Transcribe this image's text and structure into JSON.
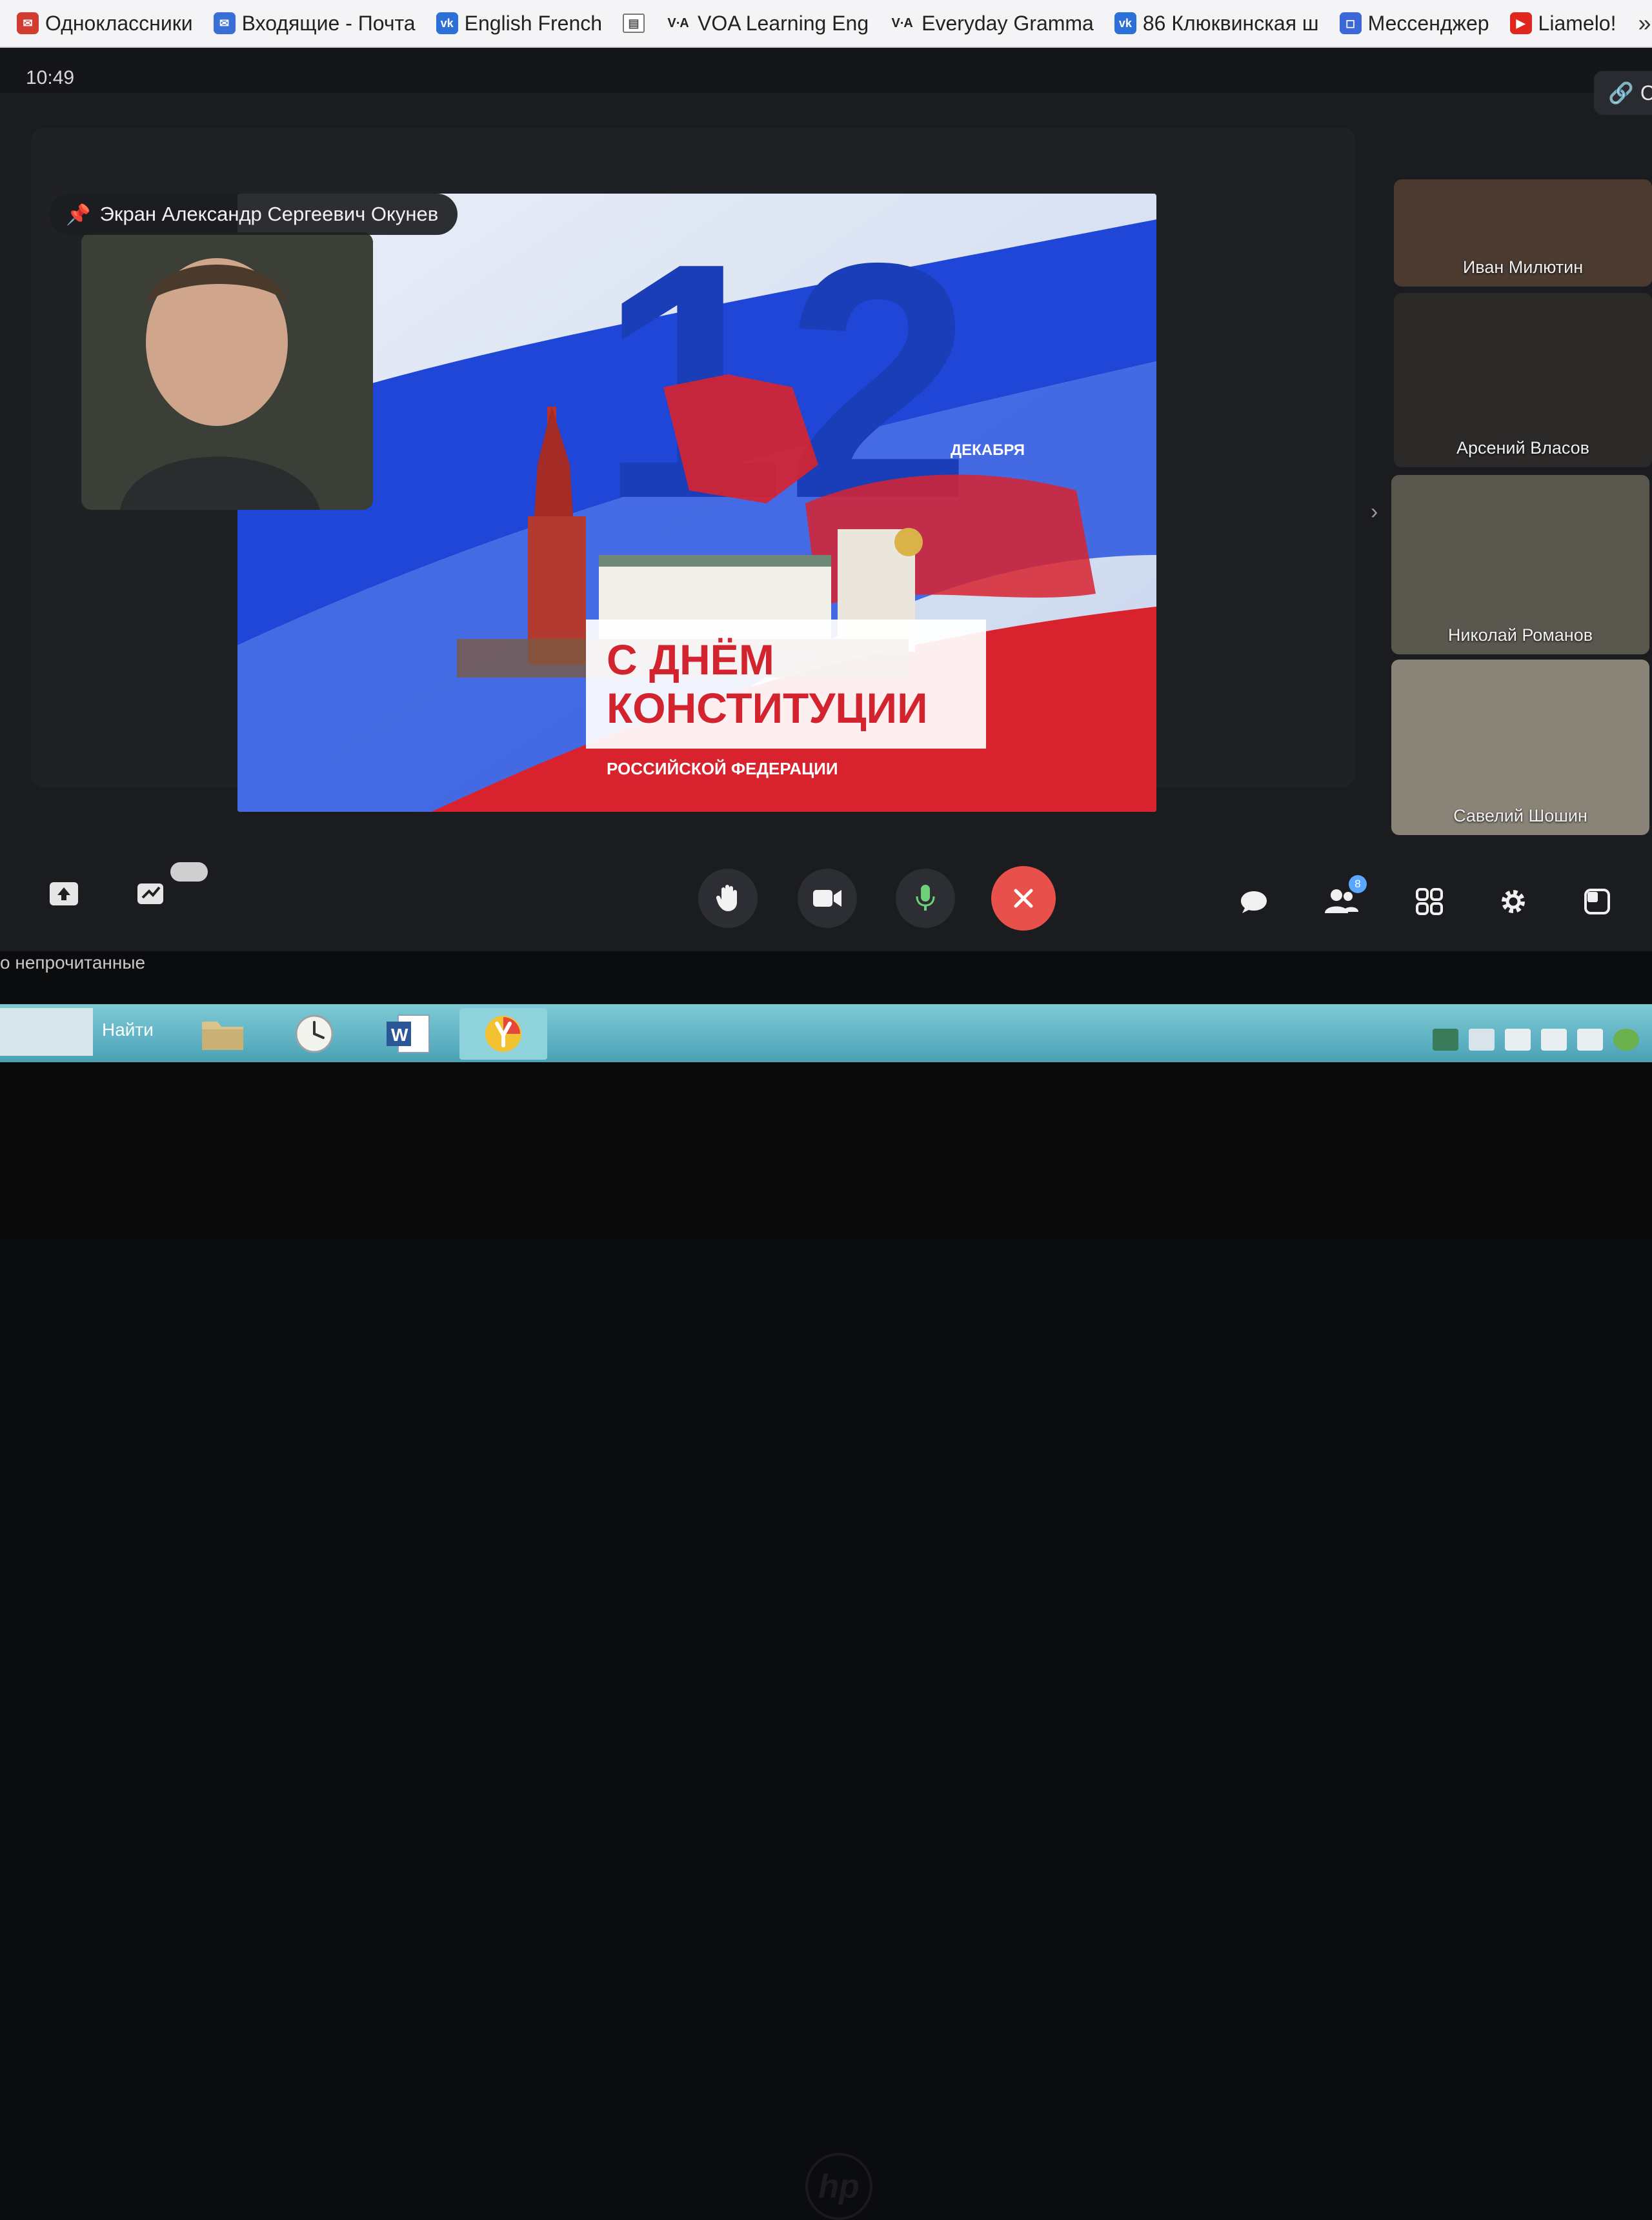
{
  "bookmarks": [
    {
      "label": "Одноклассники",
      "icon": "mail-icon",
      "color": "#d23b2f"
    },
    {
      "label": "Входящие - Почта",
      "icon": "mail-icon",
      "color": "#3a6fd8"
    },
    {
      "label": "English French",
      "icon": "vk-icon",
      "color": "#2c6fd6"
    },
    {
      "label": "",
      "icon": "book-icon",
      "color": "#555555"
    },
    {
      "label": "VOA Learning Eng",
      "icon": "voa-icon",
      "color": "#333333"
    },
    {
      "label": "Everyday Gramma",
      "icon": "voa-icon",
      "color": "#333333"
    },
    {
      "label": "86 Клюквинская ш",
      "icon": "vk-icon",
      "color": "#2c6fd6"
    },
    {
      "label": "Мессенджер",
      "icon": "messenger-icon",
      "color": "#3b67d9"
    },
    {
      "label": "Liamelo!",
      "icon": "youtube-icon",
      "color": "#e0271d"
    }
  ],
  "bookmarks_more": "»",
  "meeting": {
    "time": "10:49",
    "copy_label": "Co",
    "pin_label": "Экран Александр Сергеевич Окунев",
    "participants": [
      {
        "name": "Иван Милютин"
      },
      {
        "name": "Арсений Власов"
      },
      {
        "name": "Николай Романов"
      },
      {
        "name": "Савелий Шошин"
      }
    ],
    "participants_badge": "8"
  },
  "slide": {
    "number": "12",
    "month": "ДЕКАБРЯ",
    "line1": "С ДНЁМ",
    "line2": "КОНСТИТУЦИИ",
    "line3": "РОССИЙСКОЙ ФЕДЕРАЦИИ"
  },
  "chat": {
    "unread": "о непрочитанные"
  },
  "taskbar": {
    "search": "Найти"
  },
  "colors": {
    "end_call": "#e8504b",
    "accent": "#5aa7ff",
    "flag_blue": "#1f46d6",
    "flag_red": "#d8232f"
  }
}
